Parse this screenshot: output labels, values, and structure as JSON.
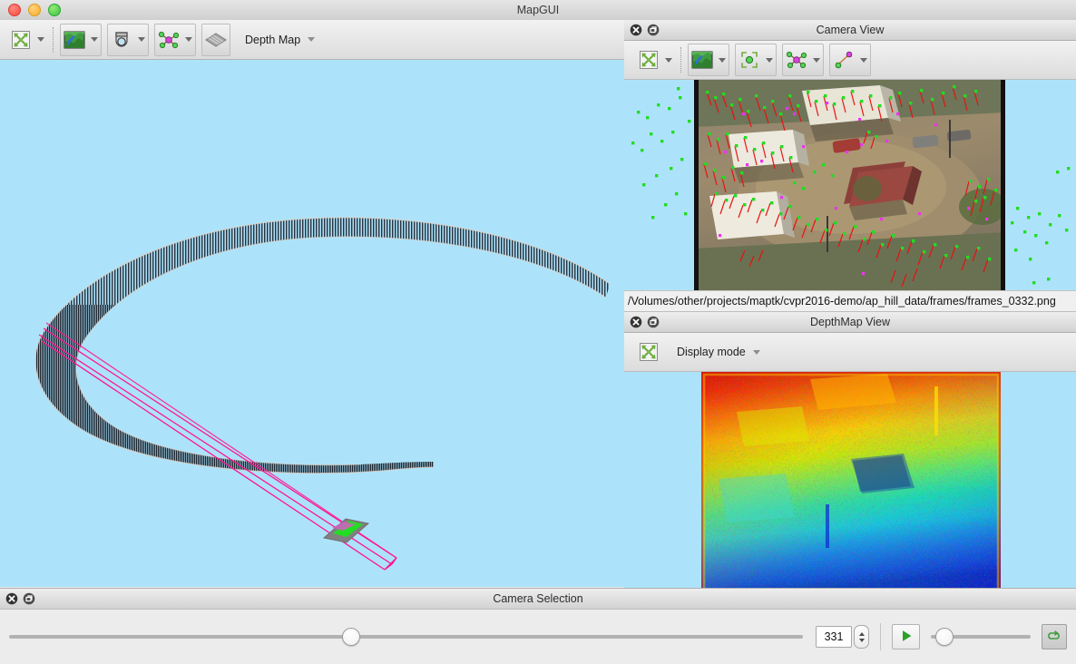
{
  "window": {
    "title": "MapGUI",
    "traffic_lights": [
      "close-light",
      "minimize-light",
      "maximize-light"
    ]
  },
  "main_toolbar": {
    "buttons": [
      {
        "name": "reset-view",
        "icon": "expand-arrows-icon",
        "has_dropdown": true
      },
      {
        "name": "show-world-map",
        "icon": "world-map-icon",
        "has_dropdown": true
      },
      {
        "name": "show-cameras",
        "icon": "camera-icon",
        "has_dropdown": true
      },
      {
        "name": "show-landmarks",
        "icon": "landmarks-icon",
        "has_dropdown": true
      },
      {
        "name": "show-depth-map",
        "icon": "depthmap-mesh-icon",
        "has_dropdown": false
      }
    ],
    "menu_label": "Depth Map"
  },
  "camera_view": {
    "title": "Camera View",
    "close_label": "×",
    "float_label": "⧉",
    "toolbar": [
      {
        "name": "reset-view",
        "icon": "expand-arrows-icon",
        "has_dropdown": true
      },
      {
        "name": "show-image",
        "icon": "world-map-icon",
        "has_dropdown": true
      },
      {
        "name": "show-feature-points",
        "icon": "feature-point-icon",
        "has_dropdown": true
      },
      {
        "name": "show-landmarks",
        "icon": "landmarks-icon",
        "has_dropdown": true
      },
      {
        "name": "show-residuals",
        "icon": "residuals-icon",
        "has_dropdown": true
      }
    ],
    "file_path": "/Volumes/other/projects/maptk/cvpr2016-demo/ap_hill_data/frames/frames_0332.png",
    "overlay_colors": {
      "feature_point": "#22dd22",
      "residual": "#e81010",
      "landmark": "#ee33ee"
    },
    "background_color": "#ade3fa"
  },
  "depthmap_view": {
    "title": "DepthMap View",
    "toolbar": [
      {
        "name": "reset-view",
        "icon": "expand-arrows-icon",
        "has_dropdown": false
      }
    ],
    "menu_label": "Display mode",
    "background_color": "#ade3fa",
    "colormap": "jet"
  },
  "camera_selection": {
    "title": "Camera Selection",
    "frame_slider": {
      "value": 331,
      "min": 1,
      "max": 660,
      "percent": 43
    },
    "frame_value": "331",
    "play_button": {
      "name": "play-button",
      "icon": "play-triangle-icon",
      "color": "#2aa22a"
    },
    "speed_slider": {
      "percent": 8
    },
    "loop_button": {
      "name": "loop-button",
      "icon": "loop-icon",
      "color": "#3f9c3f"
    }
  },
  "world_view": {
    "background_color": "#ade3fa",
    "camera_path_color": "#2b3340",
    "active_camera_color": "#ff00a0",
    "active_image_plane_color": "#22dd22"
  }
}
